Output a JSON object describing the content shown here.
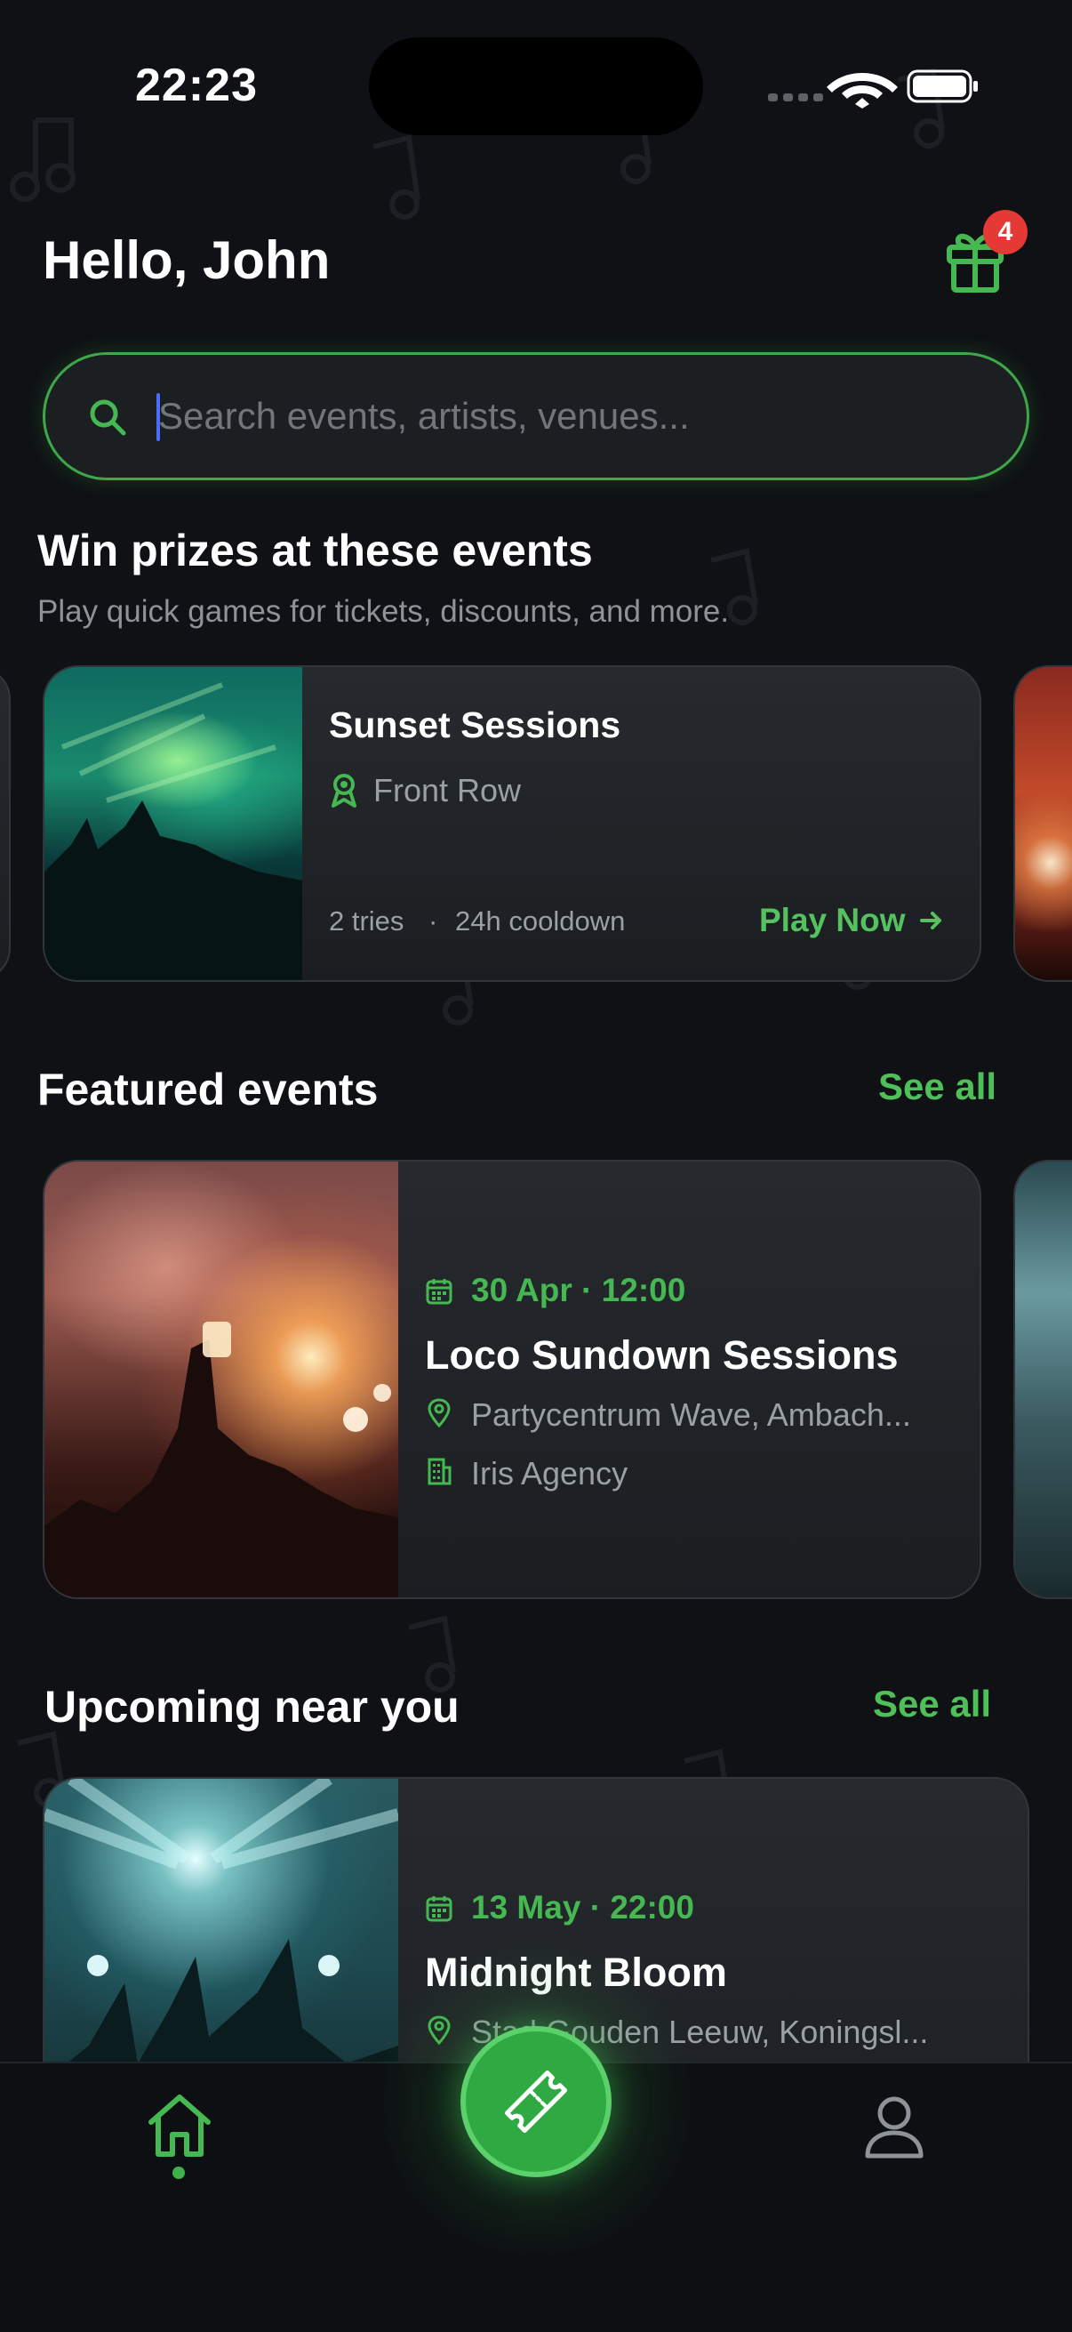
{
  "status_bar": {
    "time": "22:23"
  },
  "header": {
    "greeting": "Hello, John",
    "gift_badge_count": "4"
  },
  "search": {
    "placeholder": "Search events, artists, venues..."
  },
  "prizes": {
    "title": "Win prizes at these events",
    "subtitle": "Play quick games for tickets, discounts, and more.",
    "cards": [
      {
        "event": "Sunset Sessions",
        "prize": "Front Row",
        "tries": "2 tries",
        "separator": "·",
        "cooldown": "24h cooldown",
        "cta": "Play Now"
      }
    ]
  },
  "featured": {
    "title": "Featured events",
    "see_all": "See all",
    "cards": [
      {
        "date": "30 Apr · 12:00",
        "name": "Loco Sundown Sessions",
        "venue": "Partycentrum Wave, Ambach...",
        "organizer": "Iris Agency"
      }
    ]
  },
  "upcoming": {
    "title": "Upcoming near you",
    "see_all": "See all",
    "cards": [
      {
        "date": "13 May · 22:00",
        "name": "Midnight Bloom",
        "venue": "Stad Gouden Leeuw, Koningsl..."
      }
    ]
  },
  "nav": {
    "items": [
      "home-icon",
      "ticket-icon",
      "profile-icon"
    ],
    "active": "home"
  },
  "colors": {
    "accent": "#45b851",
    "background": "#0f1114",
    "card": "#23272b",
    "badge": "#e53935"
  }
}
